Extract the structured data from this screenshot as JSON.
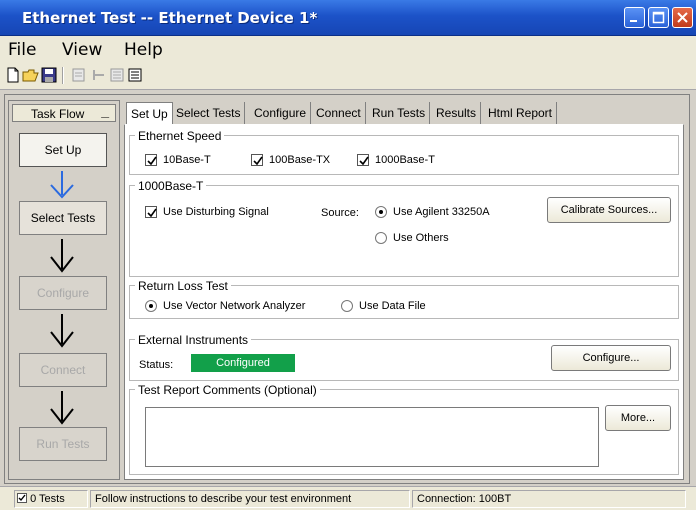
{
  "window": {
    "title": "Ethernet Test -- Ethernet Device 1*"
  },
  "menu": {
    "items": [
      "File",
      "View",
      "Help"
    ]
  },
  "toolbar": {
    "icons": [
      "new-file-icon",
      "open-folder-icon",
      "save-icon",
      "properties-icon",
      "run-icon",
      "report-icon",
      "grid-icon"
    ]
  },
  "taskflow": {
    "header": "Task Flow",
    "minimize": "_",
    "steps": [
      "Set Up",
      "Select Tests",
      "Configure",
      "Connect",
      "Run Tests"
    ]
  },
  "tabs": [
    "Set Up",
    "Select Tests",
    "Configure",
    "Connect",
    "Run Tests",
    "Results",
    "Html Report"
  ],
  "ethernet_speed": {
    "title": "Ethernet Speed",
    "options": [
      {
        "label": "10Base-T",
        "checked": true
      },
      {
        "label": "100Base-TX",
        "checked": true
      },
      {
        "label": "1000Base-T",
        "checked": true
      }
    ]
  },
  "gig": {
    "title": "1000Base-T",
    "disturbing": {
      "label": "Use Disturbing Signal",
      "checked": true
    },
    "source_label": "Source:",
    "source_options": [
      {
        "label": "Use Agilent 33250A",
        "selected": true
      },
      {
        "label": "Use Others",
        "selected": false
      }
    ],
    "calibrate_label": "Calibrate Sources..."
  },
  "return_loss": {
    "title": "Return Loss Test",
    "options": [
      {
        "label": "Use Vector Network Analyzer",
        "selected": true
      },
      {
        "label": "Use Data File",
        "selected": false
      }
    ]
  },
  "instruments": {
    "title": "External Instruments",
    "status_label": "Status:",
    "status_value": "Configured",
    "status_color": "#12a04a",
    "configure_label": "Configure..."
  },
  "comments": {
    "title": "Test Report Comments (Optional)",
    "value": "",
    "more_label": "More..."
  },
  "statusbar": {
    "tests": "0 Tests",
    "message": "Follow instructions to describe your test environment",
    "connection": "Connection: 100BT"
  }
}
